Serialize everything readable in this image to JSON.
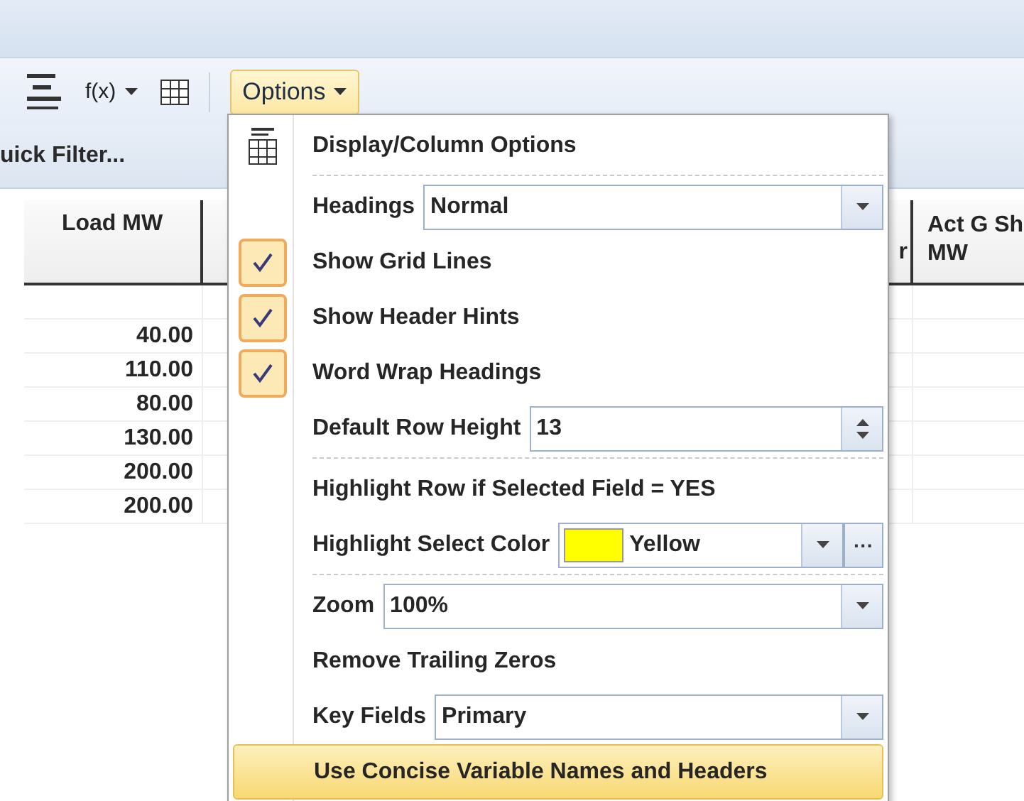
{
  "toolbar": {
    "function_button": {
      "label": "f(x)"
    },
    "options_button": {
      "label": "Options",
      "pressed": true
    }
  },
  "quick_filter": {
    "label": "uick Filter..."
  },
  "table": {
    "columns": [
      {
        "lines": [
          "Load MW"
        ]
      },
      {
        "lines": [
          "r"
        ]
      },
      {
        "lines": [
          "Act G Sh",
          "MW"
        ]
      }
    ],
    "rows": [
      {
        "cells": []
      },
      {
        "cells": [
          "40.00"
        ]
      },
      {
        "cells": [
          "110.00"
        ]
      },
      {
        "cells": [
          "80.00"
        ]
      },
      {
        "cells": [
          "130.00"
        ]
      },
      {
        "cells": [
          "200.00"
        ]
      },
      {
        "cells": [
          "200.00"
        ]
      }
    ]
  },
  "menu": {
    "items": [
      {
        "kind": "header",
        "label": "Display/Column Options",
        "highlighted": false
      },
      {
        "kind": "separator"
      },
      {
        "kind": "combo",
        "label": "Headings",
        "value": "Normal",
        "highlighted": false
      },
      {
        "kind": "check",
        "label": "Show Grid Lines",
        "checked": true,
        "highlighted": false
      },
      {
        "kind": "check",
        "label": "Show Header Hints",
        "checked": true,
        "highlighted": false
      },
      {
        "kind": "check",
        "label": "Word Wrap Headings",
        "checked": true,
        "highlighted": false
      },
      {
        "kind": "spinner",
        "label": "Default Row Height",
        "value": "13",
        "highlighted": false
      },
      {
        "kind": "separator"
      },
      {
        "kind": "text",
        "label": "Highlight Row if Selected Field = YES",
        "highlighted": false
      },
      {
        "kind": "color",
        "label": "Highlight Select Color",
        "value": "Yellow",
        "color": "#ffff00",
        "more": "···",
        "highlighted": false
      },
      {
        "kind": "separator"
      },
      {
        "kind": "combo",
        "label": "Zoom",
        "value": "100%",
        "highlighted": false
      },
      {
        "kind": "text",
        "label": "Remove Trailing Zeros",
        "highlighted": false
      },
      {
        "kind": "combo",
        "label": "Key Fields",
        "value": "Primary",
        "highlighted": false
      },
      {
        "kind": "text",
        "label": "Use Concise Variable Names and Headers",
        "highlighted": true
      }
    ]
  }
}
